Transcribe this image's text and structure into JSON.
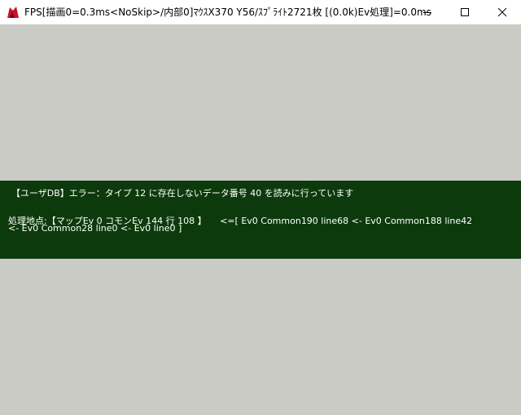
{
  "window": {
    "title": "FPS[描画0=0.3ms<NoSkip>/内部0]ﾏｳｽX370 Y56/ｽﾌﾟﾗｲﾄ2721枚 [(0.0k)Ev処理]=0.0ms",
    "icon": "wolf-rpg-editor-icon",
    "colors": {
      "titlebar": "#ffffff",
      "canvas": "#cbcbc6",
      "error_panel": "#0c3a0c",
      "error_text": "#ffffff"
    }
  },
  "error": {
    "message": "【ユーザDB】エラー：タイプ 12 に存在しないデータ番号 40 を読みに行っています",
    "location_line1": "処理地点:【マップEv 0 コモンEv 144 行 108 】　　<=[ Ev0 Common190 line68 <- Ev0 Common188 line42",
    "location_line2": "<- Ev0 Common28 line0 <- Ev0  line0 ]"
  }
}
